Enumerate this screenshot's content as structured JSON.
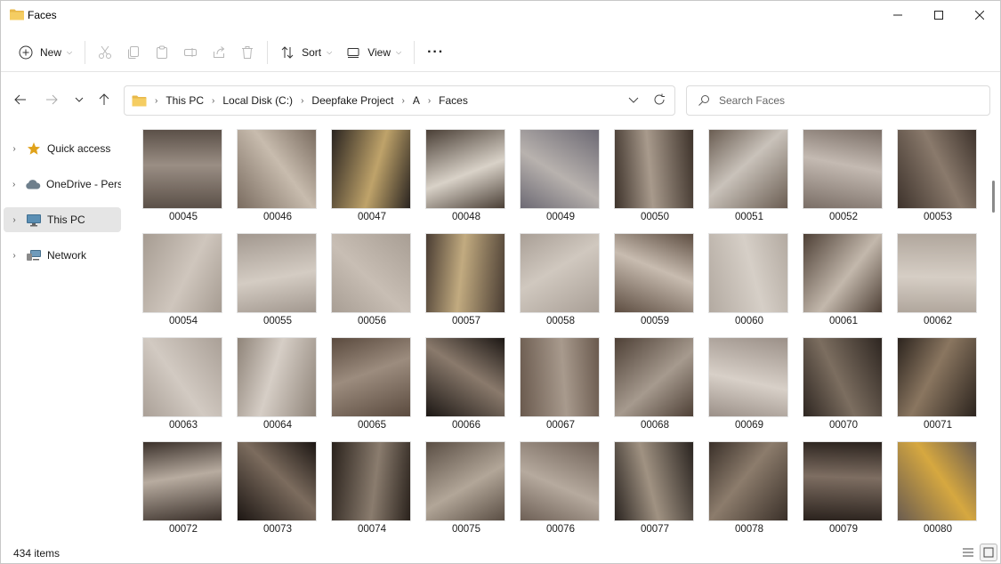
{
  "window": {
    "title": "Faces",
    "minimize_glyph": "—",
    "maximize_glyph": "☐",
    "close_glyph": "✕"
  },
  "toolbar": {
    "new_label": "New",
    "sort_label": "Sort",
    "view_label": "View",
    "more_label": "···"
  },
  "address": {
    "crumbs": [
      "This PC",
      "Local Disk (C:)",
      "Deepfake Project",
      "A",
      "Faces"
    ]
  },
  "search": {
    "placeholder": "Search Faces"
  },
  "sidebar": {
    "items": [
      {
        "label": "Quick access",
        "icon": "star-icon"
      },
      {
        "label": "OneDrive - Pers",
        "icon": "cloud-icon"
      },
      {
        "label": "This PC",
        "icon": "monitor-icon"
      },
      {
        "label": "Network",
        "icon": "network-icon"
      }
    ]
  },
  "files": [
    {
      "name": "00045",
      "c1": "#5b5048",
      "c2": "#9a8e84"
    },
    {
      "name": "00046",
      "c1": "#7a6c60",
      "c2": "#c8bcae"
    },
    {
      "name": "00047",
      "c1": "#2a2420",
      "c2": "#bfa36a"
    },
    {
      "name": "00048",
      "c1": "#4a3f36",
      "c2": "#d9d2c8"
    },
    {
      "name": "00049",
      "c1": "#6d6a74",
      "c2": "#b8b2ae"
    },
    {
      "name": "00050",
      "c1": "#3e332b",
      "c2": "#a89a8c"
    },
    {
      "name": "00051",
      "c1": "#6a5d52",
      "c2": "#c9c2ba"
    },
    {
      "name": "00052",
      "c1": "#7a6e66",
      "c2": "#c4bab2"
    },
    {
      "name": "00053",
      "c1": "#3e332c",
      "c2": "#8a7a6c"
    },
    {
      "name": "00054",
      "c1": "#a69c92",
      "c2": "#cfc6bd"
    },
    {
      "name": "00055",
      "c1": "#a2988f",
      "c2": "#d4ccc3"
    },
    {
      "name": "00056",
      "c1": "#a89e94",
      "c2": "#c8beb4"
    },
    {
      "name": "00057",
      "c1": "#4a3d33",
      "c2": "#c2ab80"
    },
    {
      "name": "00058",
      "c1": "#a99f96",
      "c2": "#d0c8bf"
    },
    {
      "name": "00059",
      "c1": "#5e4e42",
      "c2": "#c8bcb0"
    },
    {
      "name": "00060",
      "c1": "#b3aaa1",
      "c2": "#d6cfc7"
    },
    {
      "name": "00061",
      "c1": "#4e4036",
      "c2": "#c3b8ac"
    },
    {
      "name": "00062",
      "c1": "#b0a69c",
      "c2": "#d6cec5"
    },
    {
      "name": "00063",
      "c1": "#aaa097",
      "c2": "#d2cac2"
    },
    {
      "name": "00064",
      "c1": "#8f8479",
      "c2": "#d6cec6"
    },
    {
      "name": "00065",
      "c1": "#5a4a3e",
      "c2": "#9c8c7e"
    },
    {
      "name": "00066",
      "c1": "#1c1714",
      "c2": "#8a7a6c"
    },
    {
      "name": "00067",
      "c1": "#6a5a4e",
      "c2": "#a89a8d"
    },
    {
      "name": "00068",
      "c1": "#4e4036",
      "c2": "#a69a8e"
    },
    {
      "name": "00069",
      "c1": "#9b9088",
      "c2": "#d8d0c8"
    },
    {
      "name": "00070",
      "c1": "#2e2621",
      "c2": "#7c6e60"
    },
    {
      "name": "00071",
      "c1": "#2c241e",
      "c2": "#8a7660"
    },
    {
      "name": "00072",
      "c1": "#3a302a",
      "c2": "#b8aca0"
    },
    {
      "name": "00073",
      "c1": "#1c1613",
      "c2": "#7c6c5e"
    },
    {
      "name": "00074",
      "c1": "#2a221c",
      "c2": "#8a7c6e"
    },
    {
      "name": "00075",
      "c1": "#5a4e44",
      "c2": "#b2a698"
    },
    {
      "name": "00076",
      "c1": "#6e6056",
      "c2": "#b6aa9e"
    },
    {
      "name": "00077",
      "c1": "#2a2420",
      "c2": "#a09282"
    },
    {
      "name": "00078",
      "c1": "#3a3029",
      "c2": "#8c7c6c"
    },
    {
      "name": "00079",
      "c1": "#2a221d",
      "c2": "#7e6e62"
    },
    {
      "name": "00080",
      "c1": "#6a5c50",
      "c2": "#d6a840"
    }
  ],
  "status": {
    "item_count": "434 items"
  },
  "colors": {
    "folder": "#e8b84a",
    "star": "#e0a21a",
    "accent": "#0067c0"
  }
}
